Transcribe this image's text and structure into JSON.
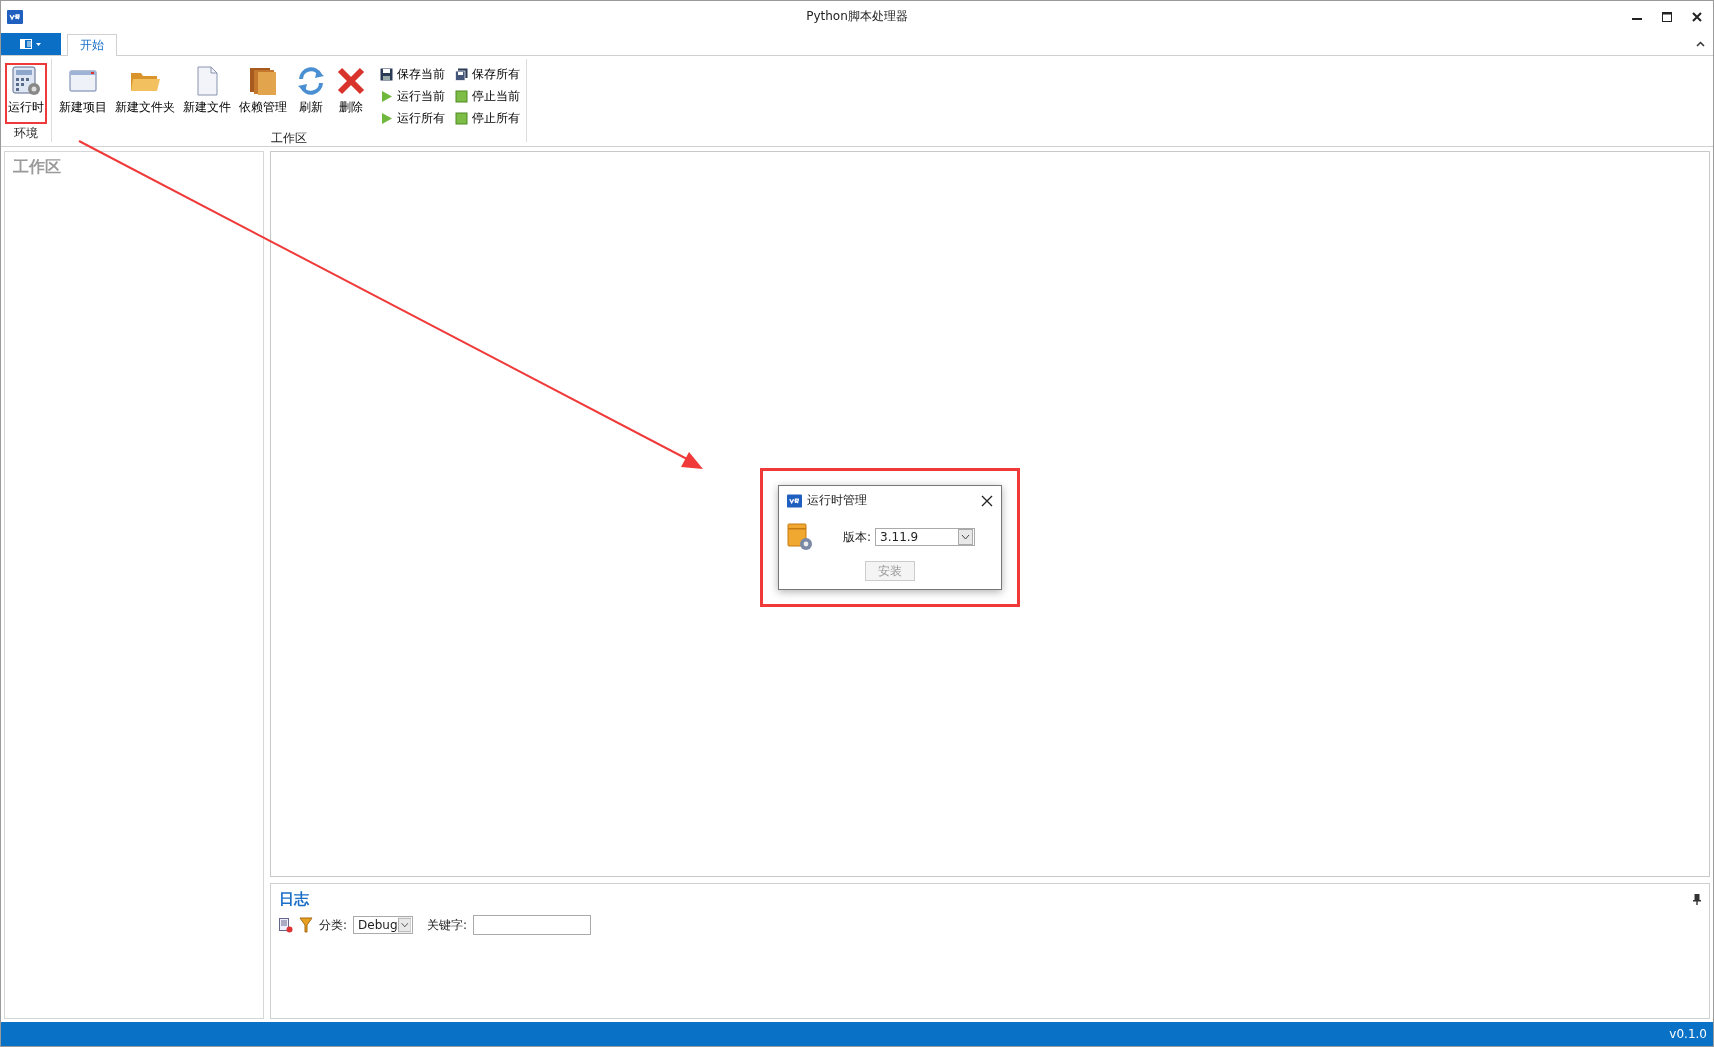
{
  "window": {
    "title": "Python脚本处理器"
  },
  "ribbon": {
    "tabs": [
      {
        "label": "开始",
        "selected": true
      }
    ],
    "groups": [
      {
        "label": "环境",
        "large_buttons": [
          {
            "label": "运行时",
            "kind": "runtime",
            "highlighted": true
          }
        ]
      },
      {
        "label": "工作区",
        "large_buttons": [
          {
            "label": "新建项目",
            "kind": "window",
            "highlighted": false
          },
          {
            "label": "新建文件夹",
            "kind": "folder",
            "highlighted": false
          },
          {
            "label": "新建文件",
            "kind": "file",
            "highlighted": false
          },
          {
            "label": "依赖管理",
            "kind": "books",
            "highlighted": false
          },
          {
            "label": "刷新",
            "kind": "refresh",
            "highlighted": false
          },
          {
            "label": "删除",
            "kind": "delete",
            "highlighted": false
          }
        ],
        "small_buttons": [
          {
            "label": "保存当前",
            "kind": "save"
          },
          {
            "label": "运行当前",
            "kind": "run"
          },
          {
            "label": "运行所有",
            "kind": "run"
          },
          {
            "label": "保存所有",
            "kind": "saveall"
          },
          {
            "label": "停止当前",
            "kind": "stop"
          },
          {
            "label": "停止所有",
            "kind": "stop"
          }
        ]
      }
    ]
  },
  "sidebar": {
    "title": "工作区"
  },
  "dialog": {
    "title": "运行时管理",
    "version_label": "版本:",
    "version_value": "3.11.9",
    "install_button": {
      "label": "安装",
      "disabled": true
    },
    "highlighted": true
  },
  "log": {
    "title": "日志",
    "category_label": "分类:",
    "category_value": "Debug",
    "keyword_label": "关键字:"
  },
  "status_bar": {
    "version": "v0.1.0"
  }
}
